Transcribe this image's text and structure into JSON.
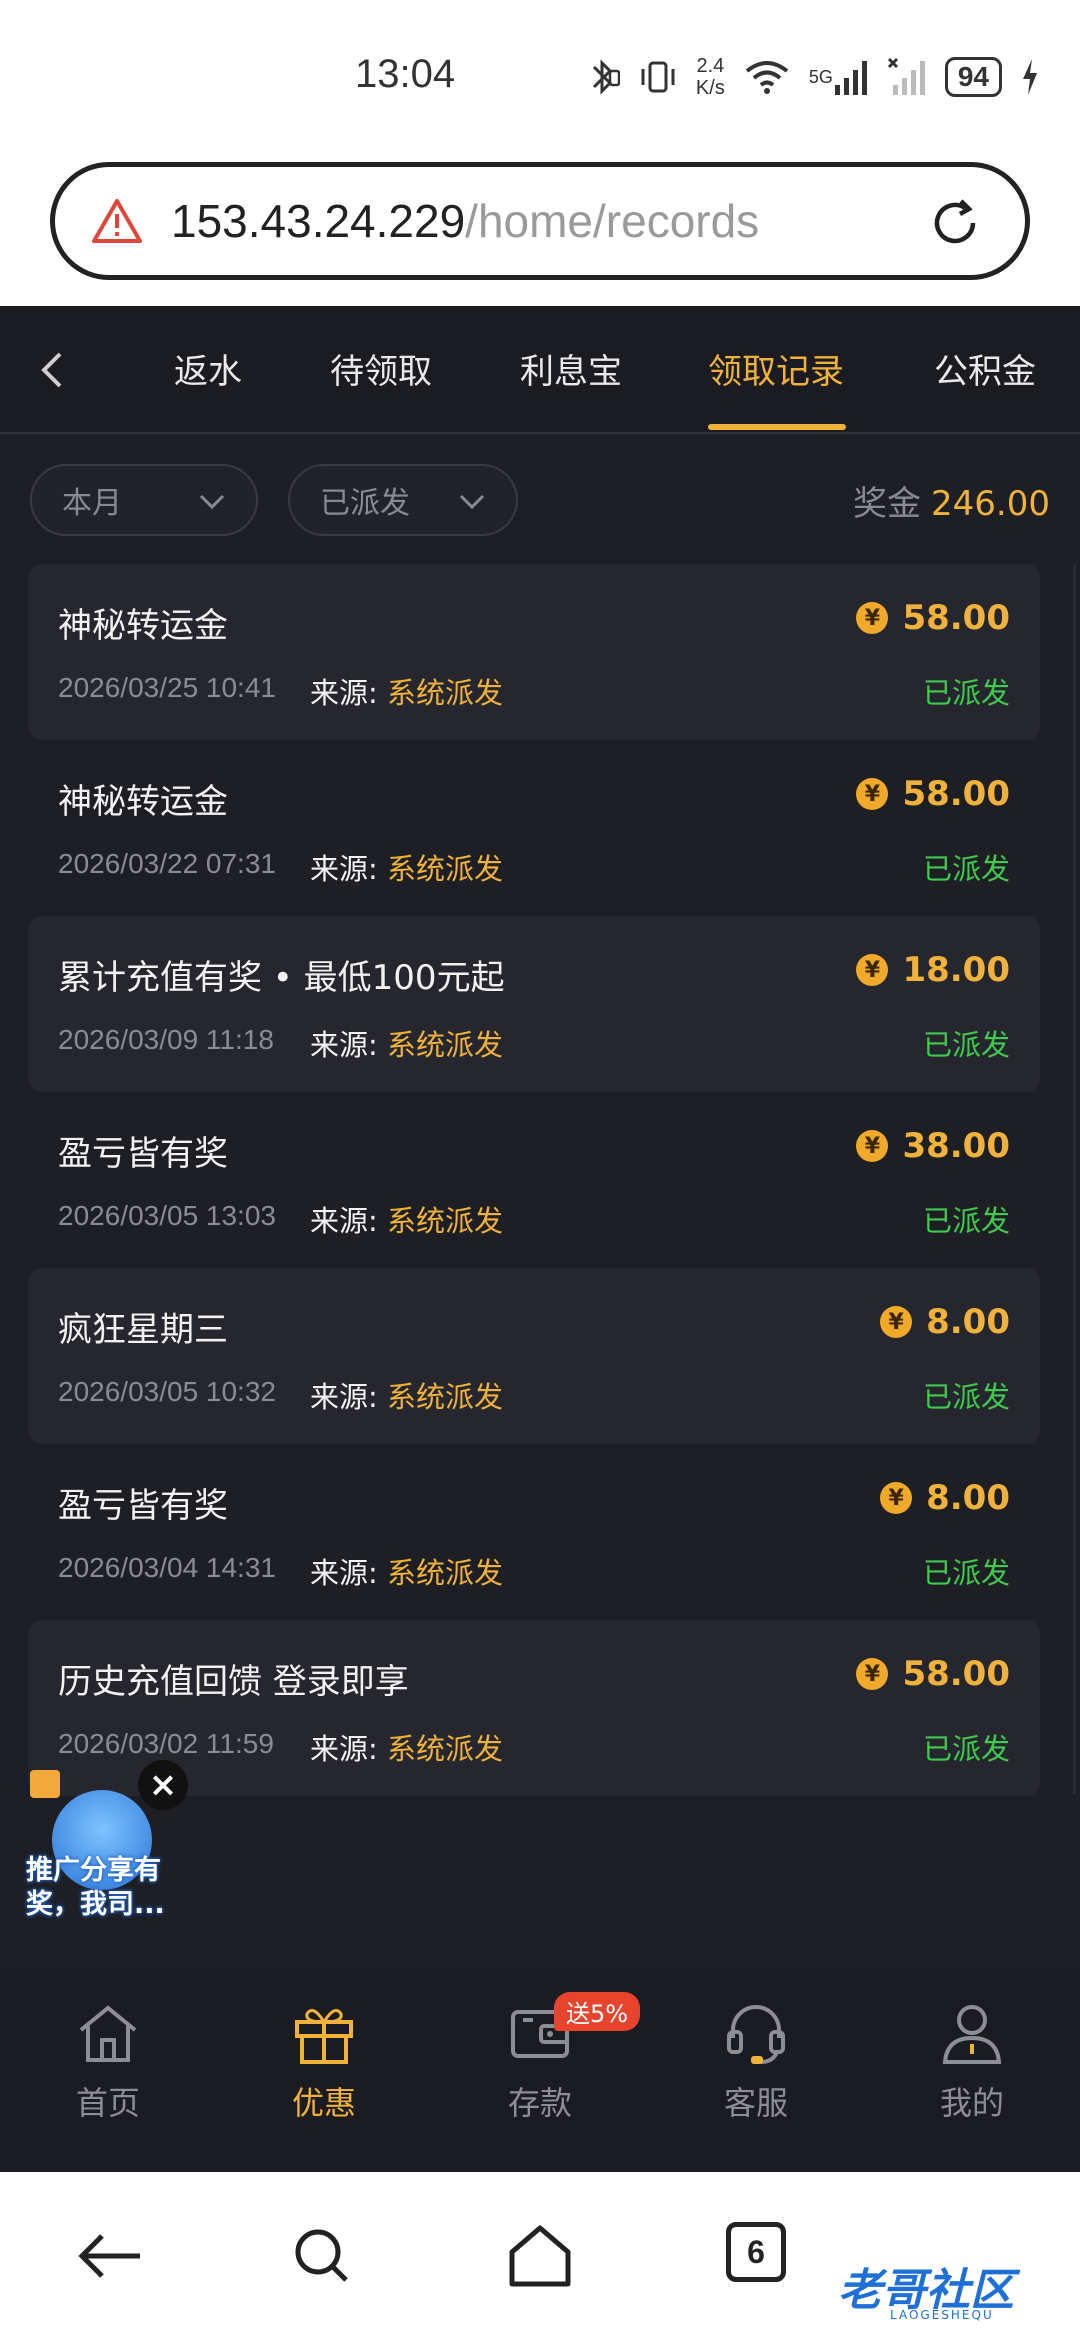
{
  "status_bar": {
    "time": "13:04",
    "net_speed_value": "2.4",
    "net_speed_unit": "K/s",
    "network_label": "5G",
    "battery": "94"
  },
  "browser": {
    "url_host": "153.43.24.229",
    "url_path": "/home/records"
  },
  "tabs": [
    {
      "label": "返水"
    },
    {
      "label": "待领取"
    },
    {
      "label": "利息宝"
    },
    {
      "label": "领取记录"
    },
    {
      "label": "公积金"
    }
  ],
  "active_tab": "领取记录",
  "filters": {
    "period": "本月",
    "status": "已派发"
  },
  "bonus": {
    "label": "奖金",
    "amount": "246.00"
  },
  "records": [
    {
      "title": "神秘转运金",
      "amount": "58.00",
      "datetime": "2026/03/25 10:41",
      "source_label": "来源:",
      "source": "系统派发",
      "status": "已派发"
    },
    {
      "title": "神秘转运金",
      "amount": "58.00",
      "datetime": "2026/03/22 07:31",
      "source_label": "来源:",
      "source": "系统派发",
      "status": "已派发"
    },
    {
      "title": "累计充值有奖 • 最低100元起",
      "amount": "18.00",
      "datetime": "2026/03/09 11:18",
      "source_label": "来源:",
      "source": "系统派发",
      "status": "已派发"
    },
    {
      "title": "盈亏皆有奖",
      "amount": "38.00",
      "datetime": "2026/03/05 13:03",
      "source_label": "来源:",
      "source": "系统派发",
      "status": "已派发"
    },
    {
      "title": "疯狂星期三",
      "amount": "8.00",
      "datetime": "2026/03/05 10:32",
      "source_label": "来源:",
      "source": "系统派发",
      "status": "已派发"
    },
    {
      "title": "盈亏皆有奖",
      "amount": "8.00",
      "datetime": "2026/03/04 14:31",
      "source_label": "来源:",
      "source": "系统派发",
      "status": "已派发"
    },
    {
      "title": "历史充值回馈 登录即享",
      "amount": "58.00",
      "datetime": "2026/03/02 11:59",
      "source_label": "来源:",
      "source": "系统派发",
      "status": "已派发"
    }
  ],
  "coin_symbol": "¥",
  "promo": {
    "text": "推广分享有奖，我司..."
  },
  "bottom_nav": [
    {
      "label": "首页",
      "icon": "home-icon"
    },
    {
      "label": "优惠",
      "icon": "gift-icon"
    },
    {
      "label": "存款",
      "icon": "wallet-icon",
      "badge": "送5%"
    },
    {
      "label": "客服",
      "icon": "headset-icon"
    },
    {
      "label": "我的",
      "icon": "user-icon"
    }
  ],
  "active_nav": "优惠",
  "system_nav": {
    "tab_count": "6"
  },
  "watermark": {
    "text": "老哥社区",
    "sub": "LAOGESHEQU"
  },
  "colors": {
    "accent": "#f0b23a",
    "success": "#3ecb4e",
    "background": "#1e1f25",
    "card": "#26272e",
    "badge": "#e8432d"
  }
}
